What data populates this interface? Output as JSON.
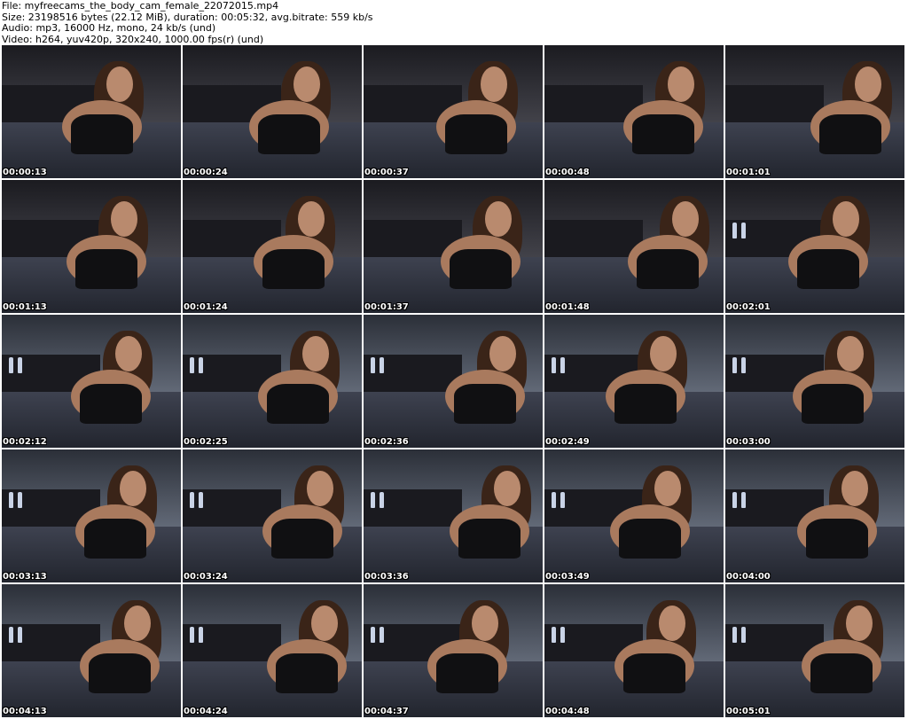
{
  "info": {
    "file_line": "File: myfreecams_the_body_cam_female_22072015.mp4",
    "size_line": "Size: 23198516 bytes (22.12 MiB), duration: 00:05:32, avg.bitrate: 559 kb/s",
    "audio_line": "Audio: mp3, 16000 Hz, mono, 24 kb/s (und)",
    "video_line": "Video: h264, yuv420p, 320x240, 1000.00 fps(r) (und)"
  },
  "thumbnails": [
    {
      "time": "00:00:13"
    },
    {
      "time": "00:00:24"
    },
    {
      "time": "00:00:37"
    },
    {
      "time": "00:00:48"
    },
    {
      "time": "00:01:01"
    },
    {
      "time": "00:01:13"
    },
    {
      "time": "00:01:24"
    },
    {
      "time": "00:01:37"
    },
    {
      "time": "00:01:48"
    },
    {
      "time": "00:02:01"
    },
    {
      "time": "00:02:12"
    },
    {
      "time": "00:02:25"
    },
    {
      "time": "00:02:36"
    },
    {
      "time": "00:02:49"
    },
    {
      "time": "00:03:00"
    },
    {
      "time": "00:03:13"
    },
    {
      "time": "00:03:24"
    },
    {
      "time": "00:03:36"
    },
    {
      "time": "00:03:49"
    },
    {
      "time": "00:04:00"
    },
    {
      "time": "00:04:13"
    },
    {
      "time": "00:04:24"
    },
    {
      "time": "00:04:37"
    },
    {
      "time": "00:04:48"
    },
    {
      "time": "00:05:01"
    }
  ]
}
